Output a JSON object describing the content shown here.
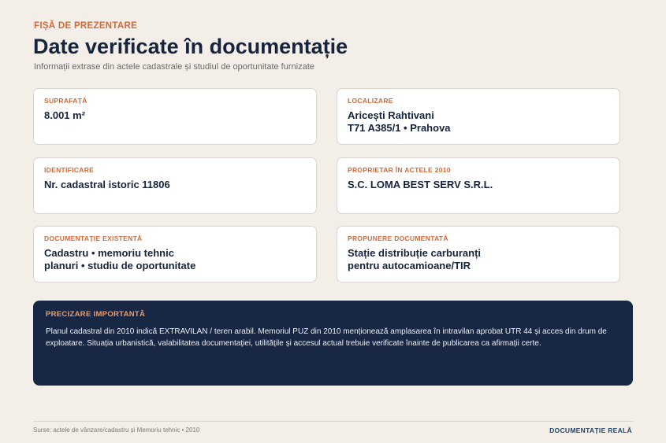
{
  "header": {
    "eyebrow": "FIȘĂ DE PREZENTARE",
    "title": "Date verificate în documentație",
    "subtitle": "Informații extrase din actele cadastrale și studiul de oportunitate furnizate"
  },
  "cards": [
    {
      "label": "SUPRAFAȚĂ",
      "lines": [
        "8.001 m²"
      ]
    },
    {
      "label": "LOCALIZARE",
      "lines": [
        "Aricești Rahtivani",
        "T71 A385/1 • Prahova"
      ]
    },
    {
      "label": "IDENTIFICARE",
      "lines": [
        "Nr. cadastral istoric 11806"
      ]
    },
    {
      "label": "PROPRIETAR ÎN ACTELE 2010",
      "lines": [
        "S.C. LOMA BEST SERV S.R.L."
      ]
    },
    {
      "label": "DOCUMENTAȚIE EXISTENTĂ",
      "lines": [
        "Cadastru • memoriu tehnic",
        "planuri • studiu de oportunitate"
      ]
    },
    {
      "label": "PROPUNERE DOCUMENTATĂ",
      "lines": [
        "Stație distribuție carburanți",
        "pentru autocamioane/TIR"
      ]
    }
  ],
  "notice": {
    "label": "PRECIZARE IMPORTANTĂ",
    "text": "Planul cadastral din 2010 indică EXTRAVILAN / teren arabil. Memoriul PUZ din 2010 menționează amplasarea în intravilan aprobat UTR 44 și acces din drum de exploatare. Situația urbanistică, valabilitatea documentației, utilitățile și accesul actual trebuie verificate înainte de publicarea ca afirmații certe."
  },
  "footer": {
    "sources": "Surse: actele de vânzare/cadastru și Memoriu tehnic • 2010",
    "tag": "DOCUMENTAȚIE REALĂ"
  },
  "colors": {
    "accent": "#d0693a",
    "navy": "#172744",
    "background": "#f3efe8"
  }
}
